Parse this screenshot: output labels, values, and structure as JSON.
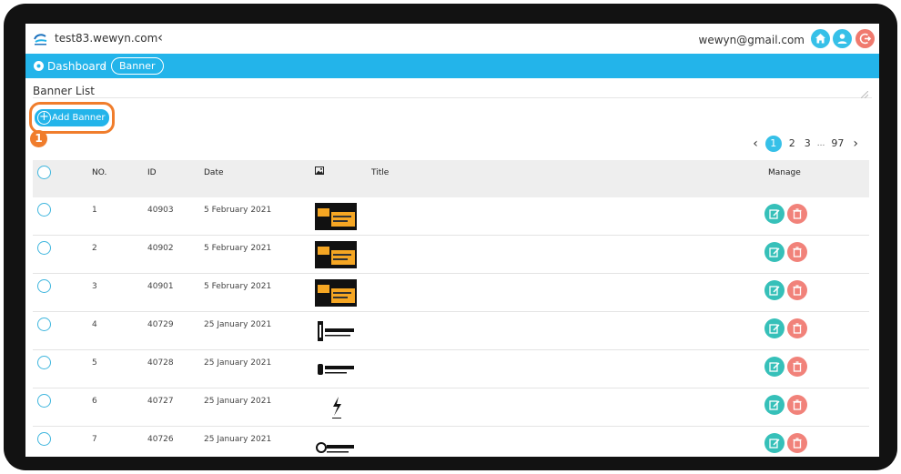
{
  "header": {
    "site_name": "test83.wewyn.com",
    "user_email": "wewyn@gmail.com",
    "icons": [
      "home-icon",
      "user-icon",
      "logout-icon"
    ]
  },
  "breadcrumb": {
    "root": "Dashboard",
    "current": "Banner"
  },
  "page": {
    "title": "Banner List",
    "add_button": "Add Banner",
    "step_badge": "1"
  },
  "pagination": {
    "pages": [
      "1",
      "2",
      "3"
    ],
    "ellipsis": "...",
    "last": "97",
    "active": "1"
  },
  "table": {
    "columns": {
      "no": "NO.",
      "id": "ID",
      "date": "Date",
      "image_icon": "image-icon",
      "title": "Title",
      "manage": "Manage"
    },
    "rows": [
      {
        "no": "1",
        "id": "40903",
        "date": "5 February 2021",
        "thumb": "black-orange-banner",
        "title": ""
      },
      {
        "no": "2",
        "id": "40902",
        "date": "5 February 2021",
        "thumb": "black-orange-banner",
        "title": ""
      },
      {
        "no": "3",
        "id": "40901",
        "date": "5 February 2021",
        "thumb": "black-orange-banner",
        "title": ""
      },
      {
        "no": "4",
        "id": "40729",
        "date": "25 January 2021",
        "thumb": "company-logo",
        "title": ""
      },
      {
        "no": "5",
        "id": "40728",
        "date": "25 January 2021",
        "thumb": "company-logo",
        "title": ""
      },
      {
        "no": "6",
        "id": "40727",
        "date": "25 January 2021",
        "thumb": "bolt-logo",
        "title": ""
      },
      {
        "no": "7",
        "id": "40726",
        "date": "25 January 2021",
        "thumb": "company-logo",
        "title": ""
      }
    ]
  },
  "colors": {
    "primary": "#23b4ea",
    "accent_orange": "#f07d2c",
    "edit": "#36c0b9",
    "delete": "#f1827a"
  }
}
